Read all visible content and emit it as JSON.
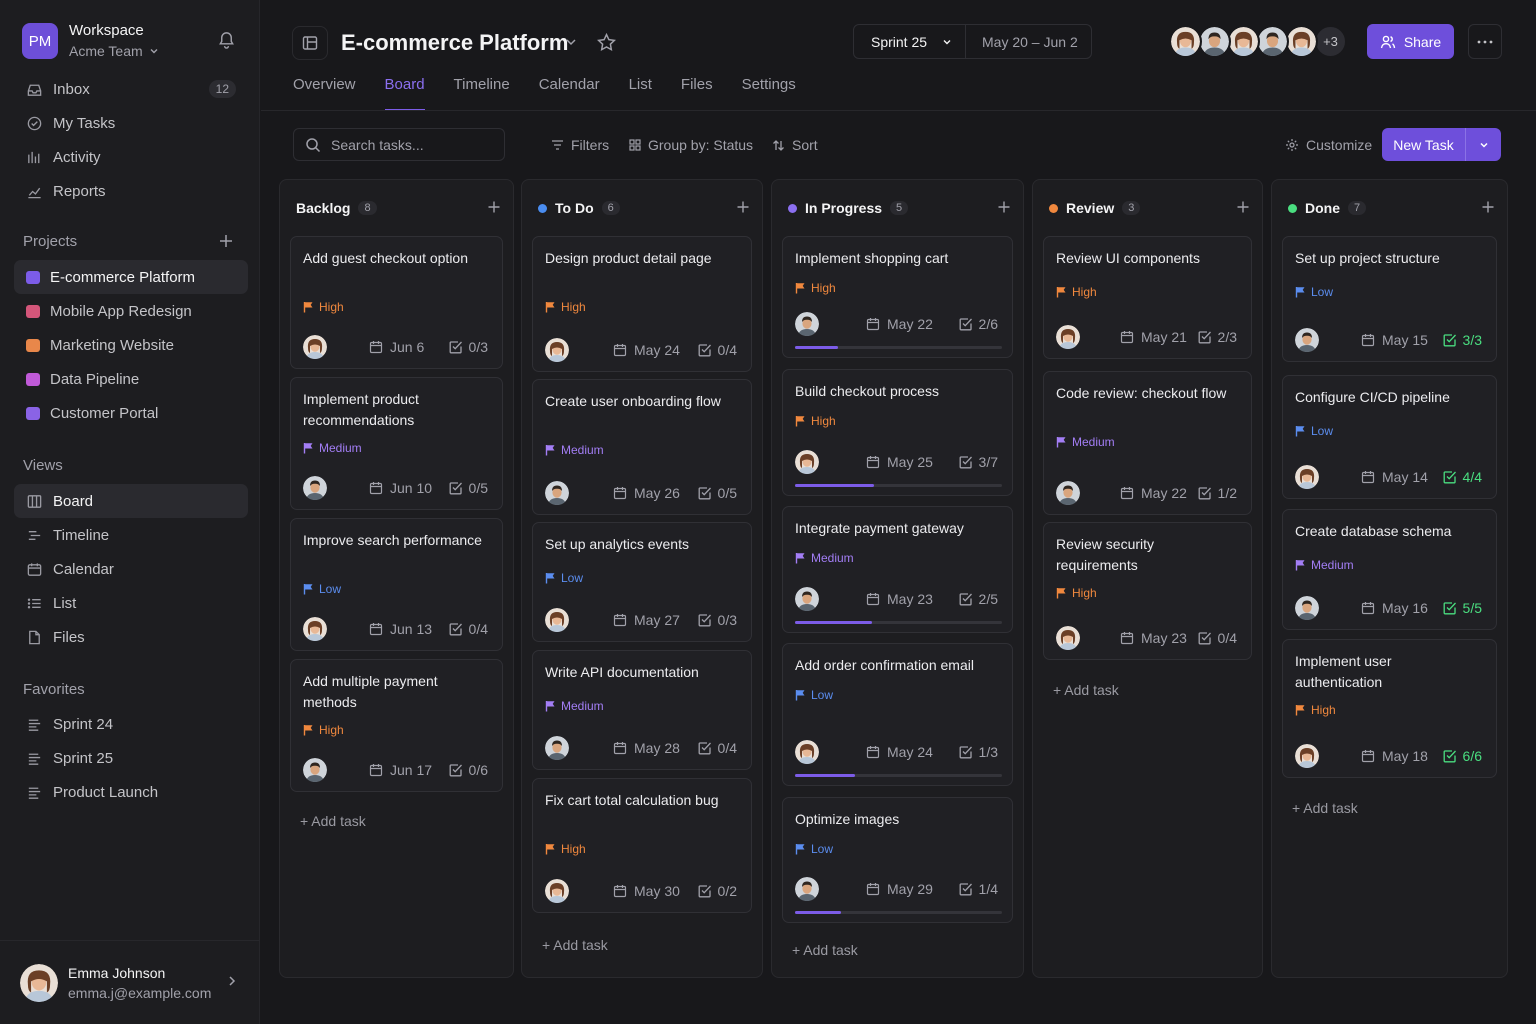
{
  "workspace": {
    "logo": "PM",
    "name": "Workspace",
    "team": "Acme Team"
  },
  "nav": [
    {
      "label": "Inbox",
      "icon": "inbox-icon",
      "badge": "12"
    },
    {
      "label": "My Tasks",
      "icon": "check-circle-icon"
    },
    {
      "label": "Activity",
      "icon": "activity-icon"
    },
    {
      "label": "Reports",
      "icon": "chart-line-icon"
    }
  ],
  "projects_heading": "Projects",
  "projects": [
    {
      "label": "E-commerce Platform",
      "color": "#7c5ce8"
    },
    {
      "label": "Mobile App Redesign",
      "color": "#d4567a"
    },
    {
      "label": "Marketing Website",
      "color": "#e8874a"
    },
    {
      "label": "Data Pipeline",
      "color": "#c05ad8"
    },
    {
      "label": "Customer Portal",
      "color": "#8a63e6"
    }
  ],
  "views_heading": "Views",
  "views": [
    {
      "label": "Board",
      "icon": "board-icon"
    },
    {
      "label": "Timeline",
      "icon": "timeline-icon"
    },
    {
      "label": "Calendar",
      "icon": "calendar-icon"
    },
    {
      "label": "List",
      "icon": "list-icon"
    },
    {
      "label": "Files",
      "icon": "file-icon"
    }
  ],
  "favorites_heading": "Favorites",
  "favorites": [
    {
      "label": "Sprint 24"
    },
    {
      "label": "Sprint 25"
    },
    {
      "label": "Product Launch"
    }
  ],
  "user": {
    "name": "Emma Johnson",
    "email": "emma.j@example.com"
  },
  "header": {
    "title": "E-commerce Platform",
    "sprint": "Sprint 25",
    "date_range": "May 20 – Jun 2",
    "avatar_more": "+3",
    "share": "Share"
  },
  "tabs": [
    "Overview",
    "Board",
    "Timeline",
    "Calendar",
    "List",
    "Files",
    "Settings"
  ],
  "active_tab": "Board",
  "toolbar": {
    "search_placeholder": "Search tasks...",
    "filters": "Filters",
    "group": "Group by: Status",
    "sort": "Sort",
    "customize": "Customize",
    "new_task": "New Task"
  },
  "add_task": "+ Add task",
  "priority_colors": {
    "High": "#f0883e",
    "Medium": "#a37ef5",
    "Low": "#5b8def"
  },
  "columns": [
    {
      "title": "Backlog",
      "count": "8",
      "dot": "",
      "cards": [
        {
          "title": "Add guest checkout option",
          "priority": "High",
          "date": "Jun 6",
          "checks": "0/3",
          "avatar": "f"
        },
        {
          "title": "Implement product recommendations",
          "priority": "Medium",
          "date": "Jun 10",
          "checks": "0/5",
          "avatar": "m"
        },
        {
          "title": "Improve search performance",
          "priority": "Low",
          "date": "Jun 13",
          "checks": "0/4",
          "avatar": "f"
        },
        {
          "title": "Add multiple payment methods",
          "priority": "High",
          "date": "Jun 17",
          "checks": "0/6",
          "avatar": "m"
        }
      ]
    },
    {
      "title": "To Do",
      "count": "6",
      "dot": "#4a8df0",
      "cards": [
        {
          "title": "Design product detail page",
          "priority": "High",
          "date": "May 24",
          "checks": "0/4",
          "avatar": "f"
        },
        {
          "title": "Create user onboarding flow",
          "priority": "Medium",
          "date": "May 26",
          "checks": "0/5",
          "avatar": "m"
        },
        {
          "title": "Set up analytics events",
          "priority": "Low",
          "date": "May 27",
          "checks": "0/3",
          "avatar": "f"
        },
        {
          "title": "Write API documentation",
          "priority": "Medium",
          "date": "May 28",
          "checks": "0/4",
          "avatar": "m"
        },
        {
          "title": "Fix cart total calculation bug",
          "priority": "High",
          "date": "May 30",
          "checks": "0/2",
          "avatar": "f"
        }
      ]
    },
    {
      "title": "In Progress",
      "count": "5",
      "dot": "#8b6ff0",
      "cards": [
        {
          "title": "Implement shopping cart",
          "priority": "High",
          "date": "May 22",
          "checks": "2/6",
          "avatar": "m",
          "progress": 0.21
        },
        {
          "title": "Build checkout process",
          "priority": "High",
          "date": "May 25",
          "checks": "3/7",
          "avatar": "f",
          "progress": 0.38
        },
        {
          "title": "Integrate payment gateway",
          "priority": "Medium",
          "date": "May 23",
          "checks": "2/5",
          "avatar": "m",
          "progress": 0.37
        },
        {
          "title": "Add order confirmation email",
          "priority": "Low",
          "date": "May 24",
          "checks": "1/3",
          "avatar": "f",
          "progress": 0.29
        },
        {
          "title": "Optimize images",
          "priority": "Low",
          "date": "May 29",
          "checks": "1/4",
          "avatar": "m",
          "progress": 0.22
        }
      ]
    },
    {
      "title": "Review",
      "count": "3",
      "dot": "#f0883e",
      "cards": [
        {
          "title": "Review UI components",
          "priority": "High",
          "date": "May 21",
          "checks": "2/3",
          "avatar": "f"
        },
        {
          "title": "Code review: checkout flow",
          "priority": "Medium",
          "date": "May 22",
          "checks": "1/2",
          "avatar": "m"
        },
        {
          "title": "Review security requirements",
          "priority": "High",
          "date": "May 23",
          "checks": "0/4",
          "avatar": "f"
        }
      ]
    },
    {
      "title": "Done",
      "count": "7",
      "dot": "#4ade80",
      "cards": [
        {
          "title": "Set up project structure",
          "priority": "Low",
          "date": "May 15",
          "checks": "3/3",
          "avatar": "m",
          "done": true
        },
        {
          "title": "Configure CI/CD pipeline",
          "priority": "Low",
          "date": "May 14",
          "checks": "4/4",
          "avatar": "f",
          "done": true
        },
        {
          "title": "Create database schema",
          "priority": "Medium",
          "date": "May 16",
          "checks": "5/5",
          "avatar": "m",
          "done": true
        },
        {
          "title": "Implement user authentication",
          "priority": "High",
          "date": "May 18",
          "checks": "6/6",
          "avatar": "f",
          "done": true
        }
      ]
    }
  ]
}
